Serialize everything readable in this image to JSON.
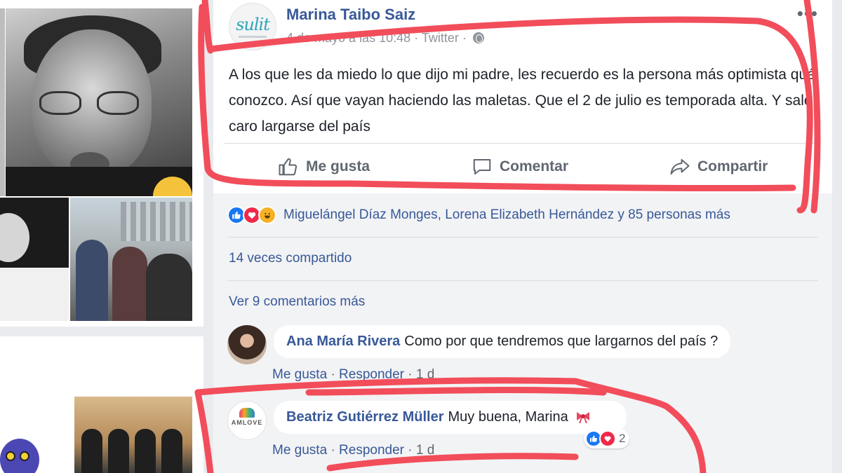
{
  "post": {
    "author": "Marina Taibo Saiz",
    "timestamp": "4 de mayo a las 10:48",
    "source": "Twitter",
    "avatar_logo": "sulit",
    "text": "A los que les da miedo lo que dijo mi padre, les recuerdo es la persona más optimista qué conozco. Así que vayan haciendo las maletas. Que el 2 de julio es temporada alta. Y sale caro largarse del país",
    "more_icon": "more-dots-icon",
    "privacy_icon": "globe-icon"
  },
  "actions": {
    "like": "Me gusta",
    "comment": "Comentar",
    "share": "Compartir"
  },
  "reactions": {
    "types": [
      "like",
      "love",
      "haha"
    ],
    "names": "Miguelángel Díaz Monges, Lorena Elizabeth Hernández y 85 personas más"
  },
  "shares": "14 veces compartido",
  "more_comments": "Ver 9 comentarios más",
  "comments": [
    {
      "author": "Ana María Rivera",
      "text": "Como por que tendremos que largarnos del país ?",
      "like": "Me gusta",
      "reply": "Responder",
      "time": "1 d"
    },
    {
      "author": "Beatriz Gutiérrez Müller",
      "text": "Muy buena, Marina",
      "like": "Me gusta",
      "reply": "Responder",
      "time": "1 d",
      "reaction_count": "2",
      "avatar_logo": "AMLOVE"
    }
  ],
  "colors": {
    "link": "#385898",
    "secondary": "#90949c",
    "annotation": "#f24d5a",
    "like_blue": "#1877f2",
    "love_red": "#f0284a",
    "haha_yellow": "#f7b125"
  }
}
